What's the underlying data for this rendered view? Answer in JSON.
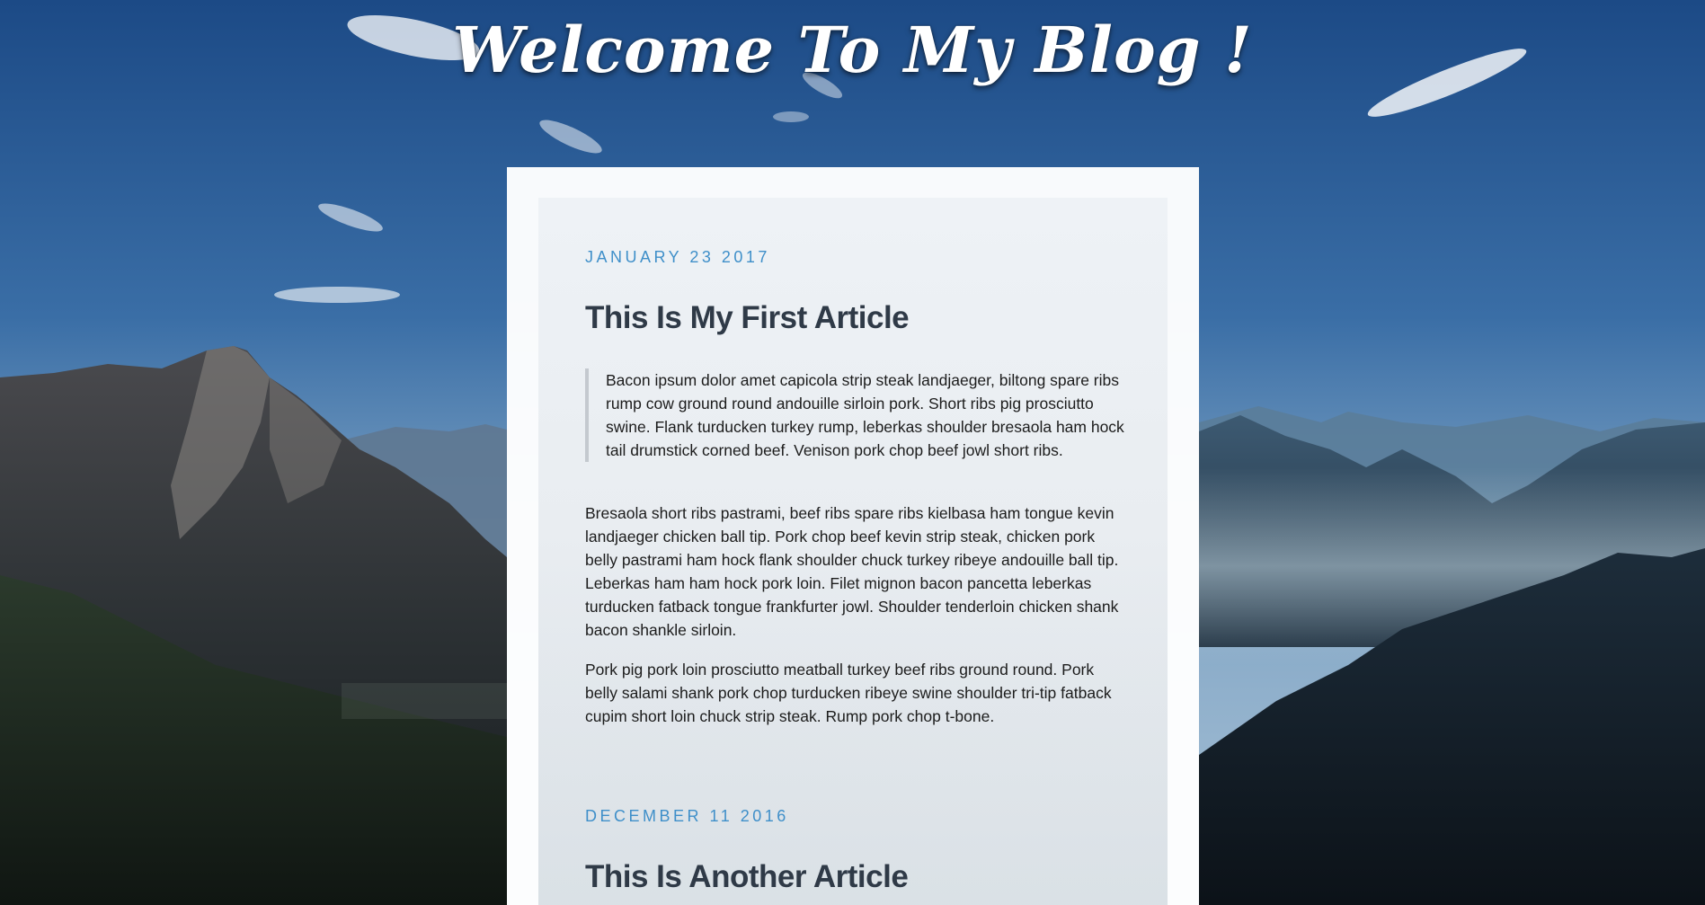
{
  "site": {
    "title": "Welcome To My Blog !"
  },
  "colors": {
    "date_accent": "#3f8fc9",
    "title_text": "#2f3a47",
    "sky_top": "#1f4f8a",
    "sky_bottom": "#7fa6c8"
  },
  "articles": [
    {
      "date": "JANUARY 23 2017",
      "title": "This Is My First Article",
      "quote": "Bacon ipsum dolor amet capicola strip steak landjaeger, biltong spare ribs rump cow ground round andouille sirloin pork. Short ribs pig prosciutto swine. Flank turducken turkey rump, leberkas shoulder bresaola ham hock tail drumstick corned beef. Venison pork chop beef jowl short ribs.",
      "paragraphs": [
        "Bresaola short ribs pastrami, beef ribs spare ribs kielbasa ham tongue kevin landjaeger chicken ball tip. Pork chop beef kevin strip steak, chicken pork belly pastrami ham hock flank shoulder chuck turkey ribeye andouille ball tip. Leberkas ham ham hock pork loin. Filet mignon bacon pancetta leberkas turducken fatback tongue frankfurter jowl. Shoulder tenderloin chicken shank bacon shankle sirloin.",
        "Pork pig pork loin prosciutto meatball turkey beef ribs ground round. Pork belly salami shank pork chop turducken ribeye swine shoulder tri-tip fatback cupim short loin chuck strip steak. Rump pork chop t-bone."
      ]
    },
    {
      "date": "DECEMBER 11 2016",
      "title": "This Is Another Article"
    }
  ]
}
